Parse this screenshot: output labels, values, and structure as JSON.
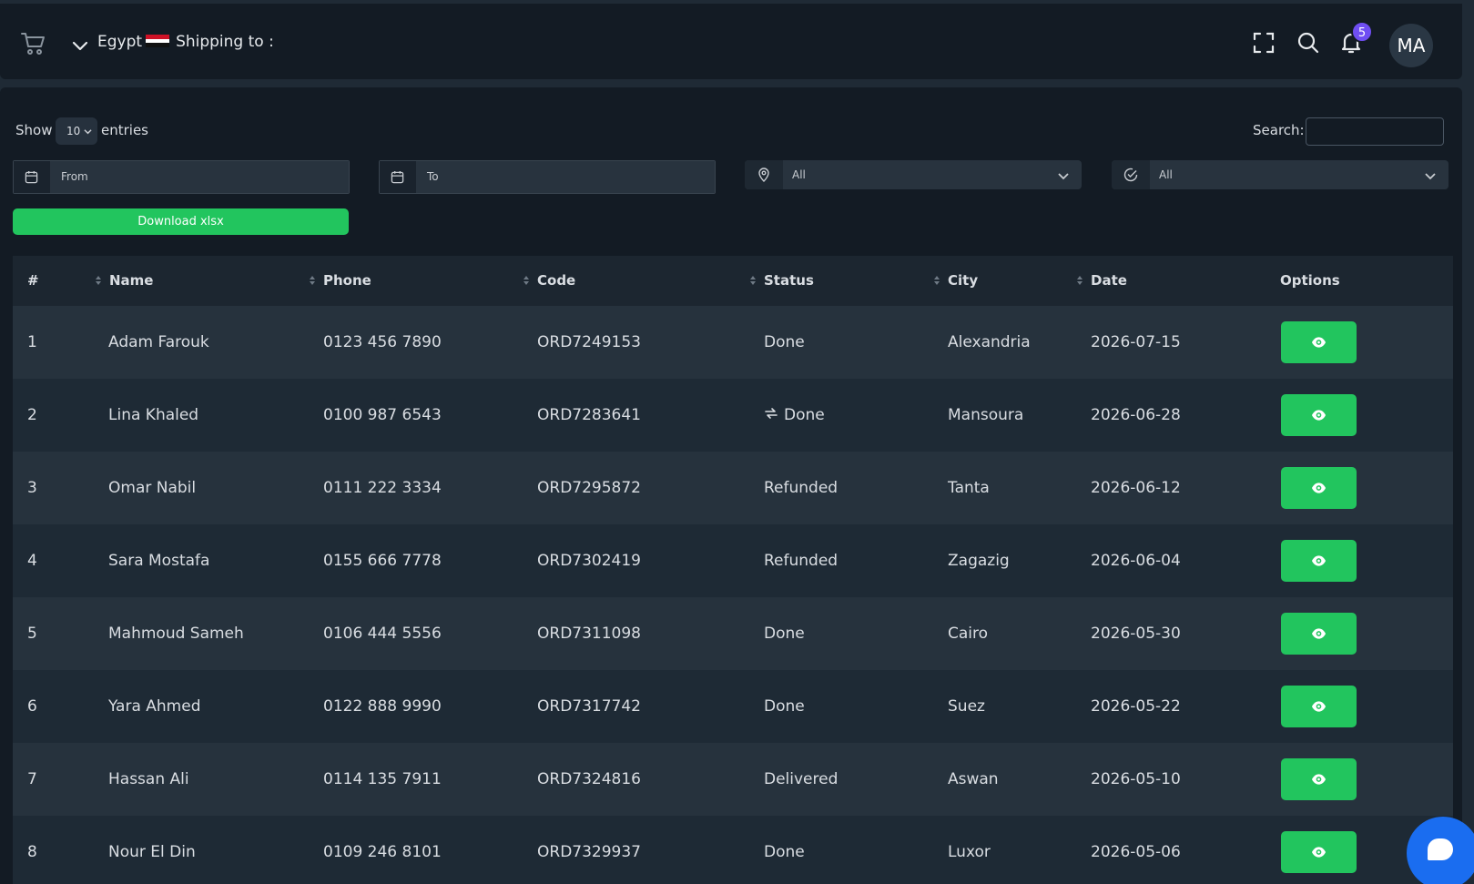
{
  "header": {
    "country": "Egypt",
    "shipping_label": "Shipping to :",
    "notification_count": "5",
    "avatar_initials": "MA",
    "icons": [
      "cart-icon",
      "chevron-down-icon",
      "fullscreen-icon",
      "search-icon",
      "bell-icon"
    ]
  },
  "controls": {
    "show_label": "Show",
    "page_size": "10",
    "entries_label": "entries",
    "search_label": "Search:",
    "search_value": "",
    "from_placeholder": "From",
    "to_placeholder": "To",
    "city_filter": "All",
    "status_filter": "All",
    "download_label": "Download xlsx"
  },
  "table": {
    "columns": [
      "#",
      "Name",
      "Phone",
      "Code",
      "Status",
      "City",
      "Date",
      "Options"
    ],
    "rows": [
      {
        "num": "1",
        "name": "Adam Farouk",
        "phone": "0123 456 7890",
        "code": "ORD7249153",
        "status": "Done",
        "city": "Alexandria",
        "date": "2026-07-15"
      },
      {
        "num": "2",
        "name": "Lina Khaled",
        "phone": "0100 987 6543",
        "code": "ORD7283641",
        "status": "Done",
        "status_icon": "refresh-icon",
        "city": "Mansoura",
        "date": "2026-06-28"
      },
      {
        "num": "3",
        "name": "Omar Nabil",
        "phone": "0111 222 3334",
        "code": "ORD7295872",
        "status": "Refunded",
        "city": "Tanta",
        "date": "2026-06-12"
      },
      {
        "num": "4",
        "name": "Sara Mostafa",
        "phone": "0155 666 7778",
        "code": "ORD7302419",
        "status": "Refunded",
        "city": "Zagazig",
        "date": "2026-06-04"
      },
      {
        "num": "5",
        "name": "Mahmoud Sameh",
        "phone": "0106 444 5556",
        "code": "ORD7311098",
        "status": "Done",
        "city": "Cairo",
        "date": "2026-05-30"
      },
      {
        "num": "6",
        "name": "Yara Ahmed",
        "phone": "0122 888 9990",
        "code": "ORD7317742",
        "status": "Done",
        "city": "Suez",
        "date": "2026-05-22"
      },
      {
        "num": "7",
        "name": "Hassan Ali",
        "phone": "0114 135 7911",
        "code": "ORD7324816",
        "status": "Delivered",
        "city": "Aswan",
        "date": "2026-05-10"
      },
      {
        "num": "8",
        "name": "Nour El Din",
        "phone": "0109 246 8101",
        "code": "ORD7329937",
        "status": "Done",
        "city": "Luxor",
        "date": "2026-05-06"
      }
    ]
  },
  "colors": {
    "accent_green": "#22c55e",
    "badge_purple": "#6f4ef2",
    "chat_blue": "#1a6df0",
    "background": "#131b24"
  }
}
